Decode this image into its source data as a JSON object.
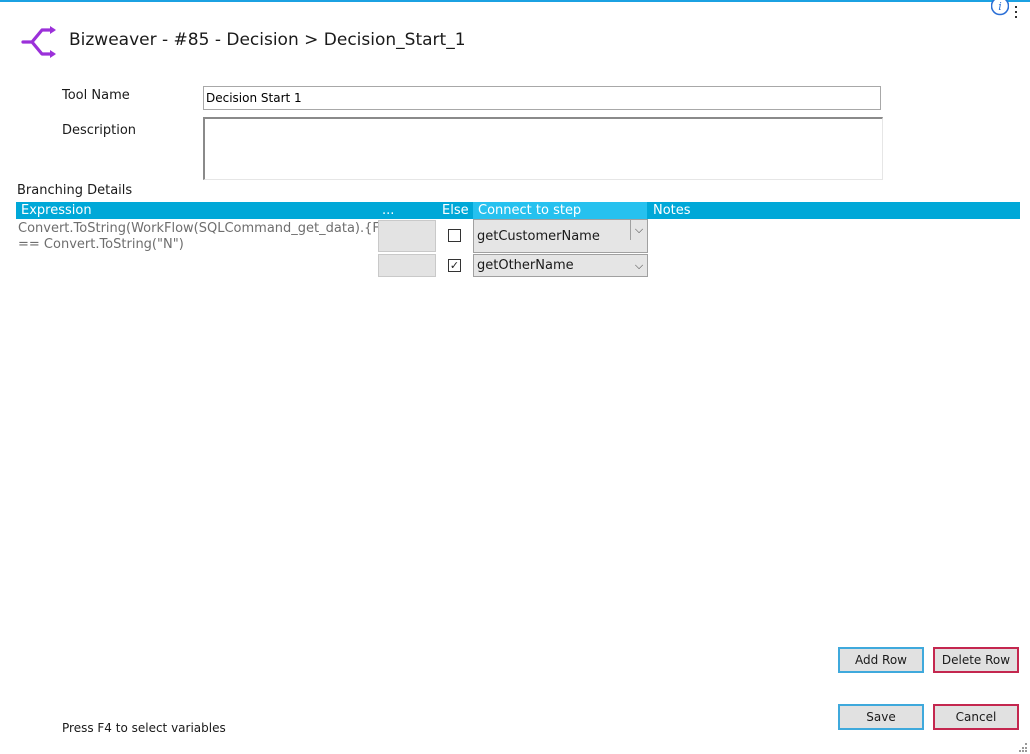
{
  "window": {
    "title": "Bizweaver - #85 - Decision > Decision_Start_1"
  },
  "icons": {
    "app": "decision-branch-icon",
    "info": "info-icon",
    "menu": "vertical-dots-icon"
  },
  "colors": {
    "accent": "#00a8d8",
    "header_highlight": "#26c1ef",
    "logo": "#9b30d9",
    "danger_border": "#c4274f",
    "primary_border": "#3fa9dc"
  },
  "form": {
    "tool_name_label": "Tool Name",
    "tool_name_value": "Decision Start 1",
    "description_label": "Description",
    "description_value": ""
  },
  "branching": {
    "label": "Branching Details",
    "columns": {
      "expression": "Expression",
      "dots": "...",
      "else": "Else",
      "connect": "Connect to step",
      "notes": "Notes"
    },
    "rows": [
      {
        "expression_line1": "Convert.ToString(WorkFlow(SQLCommand_get_data).{FIELD",
        "expression_line2": "== Convert.ToString(\"N\")",
        "else_checked": false,
        "else_mark": "",
        "connect_to": "getCustomerName"
      },
      {
        "expression_line1": "",
        "expression_line2": "",
        "else_checked": true,
        "else_mark": "✓",
        "connect_to": "getOtherName"
      }
    ]
  },
  "buttons": {
    "add_row": "Add Row",
    "delete_row": "Delete Row",
    "save": "Save",
    "cancel": "Cancel"
  },
  "status": {
    "hint": "Press F4 to select variables"
  }
}
